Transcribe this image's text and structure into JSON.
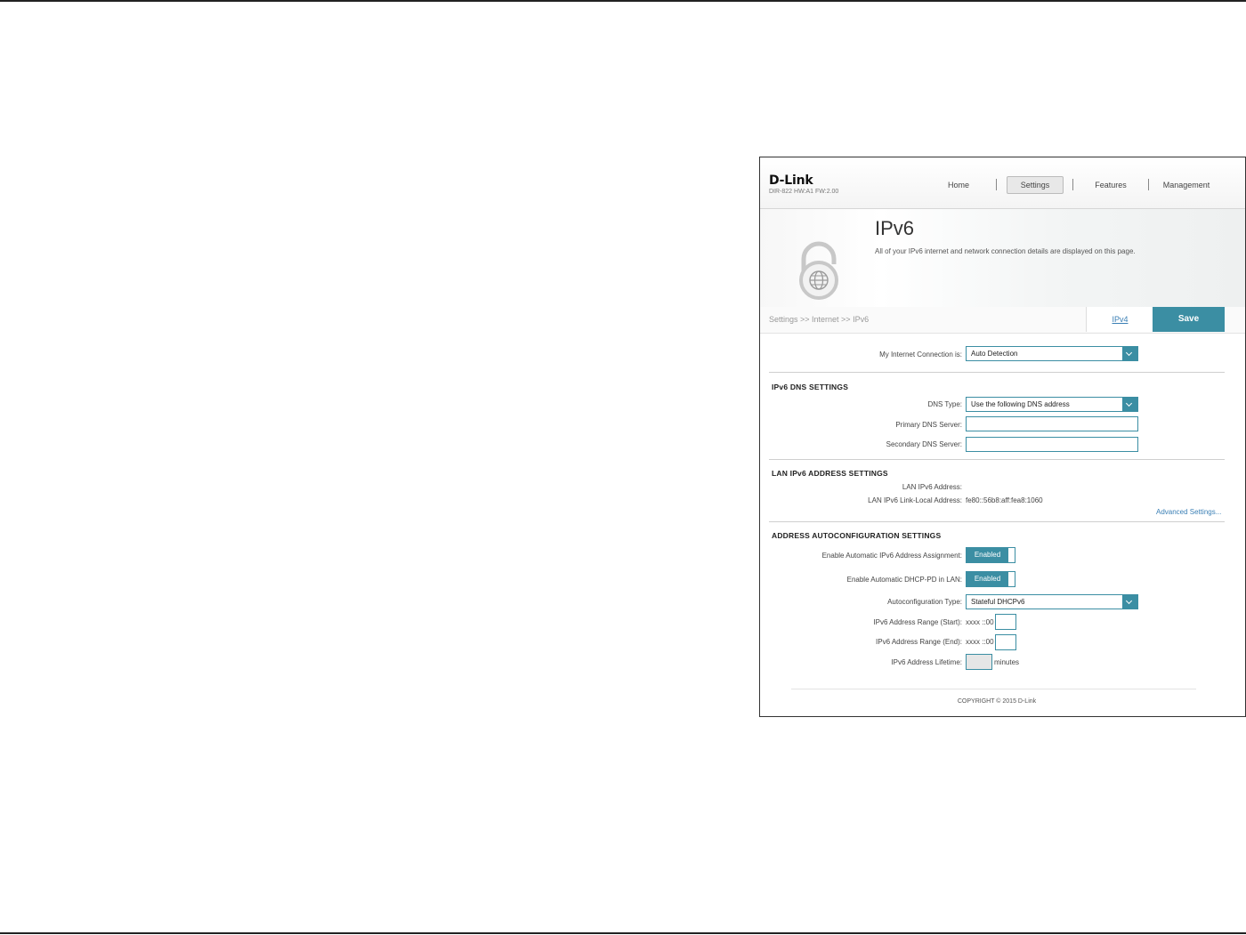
{
  "header": {
    "logo": "D-Link",
    "model": "DIR-822 HW:A1 FW:2.00",
    "nav": {
      "home": "Home",
      "settings": "Settings",
      "features": "Features",
      "management": "Management"
    }
  },
  "banner": {
    "title": "IPv6",
    "description": "All of your IPv6 internet and network connection details are displayed on this page.",
    "icon": "lock-globe-icon"
  },
  "breadcrumb": "Settings >> Internet >> IPv6",
  "tabs": {
    "ipv4": "IPv4",
    "save": "Save"
  },
  "connection": {
    "label": "My Internet Connection is:",
    "value": "Auto Detection"
  },
  "dns": {
    "title": "IPv6 DNS SETTINGS",
    "type_label": "DNS Type:",
    "type_value": "Use the following DNS address",
    "primary_label": "Primary DNS Server:",
    "primary_value": "",
    "secondary_label": "Secondary DNS Server:",
    "secondary_value": ""
  },
  "lan": {
    "title": "LAN IPv6 ADDRESS SETTINGS",
    "address_label": "LAN IPv6 Address:",
    "address_value": "",
    "link_local_label": "LAN IPv6 Link-Local Address:",
    "link_local_value": "fe80::56b8:aff:fea8:1060",
    "advanced": "Advanced Settings..."
  },
  "autoconf": {
    "title": "ADDRESS AUTOCONFIGURATION SETTINGS",
    "assign_label": "Enable Automatic IPv6 Address Assignment:",
    "assign_state": "Enabled",
    "dhcppd_label": "Enable Automatic DHCP-PD in LAN:",
    "dhcppd_state": "Enabled",
    "type_label": "Autoconfiguration Type:",
    "type_value": "Stateful DHCPv6",
    "range_start_label": "IPv6 Address Range (Start):",
    "range_start_prefix": "xxxx ::00",
    "range_end_label": "IPv6 Address Range (End):",
    "range_end_prefix": "xxxx ::00",
    "lifetime_label": "IPv6 Address Lifetime:",
    "lifetime_unit": "minutes"
  },
  "footer": {
    "copyright": "COPYRIGHT © 2015 D-Link"
  },
  "colors": {
    "accent": "#3b8ea3",
    "link": "#3a7fb5"
  }
}
